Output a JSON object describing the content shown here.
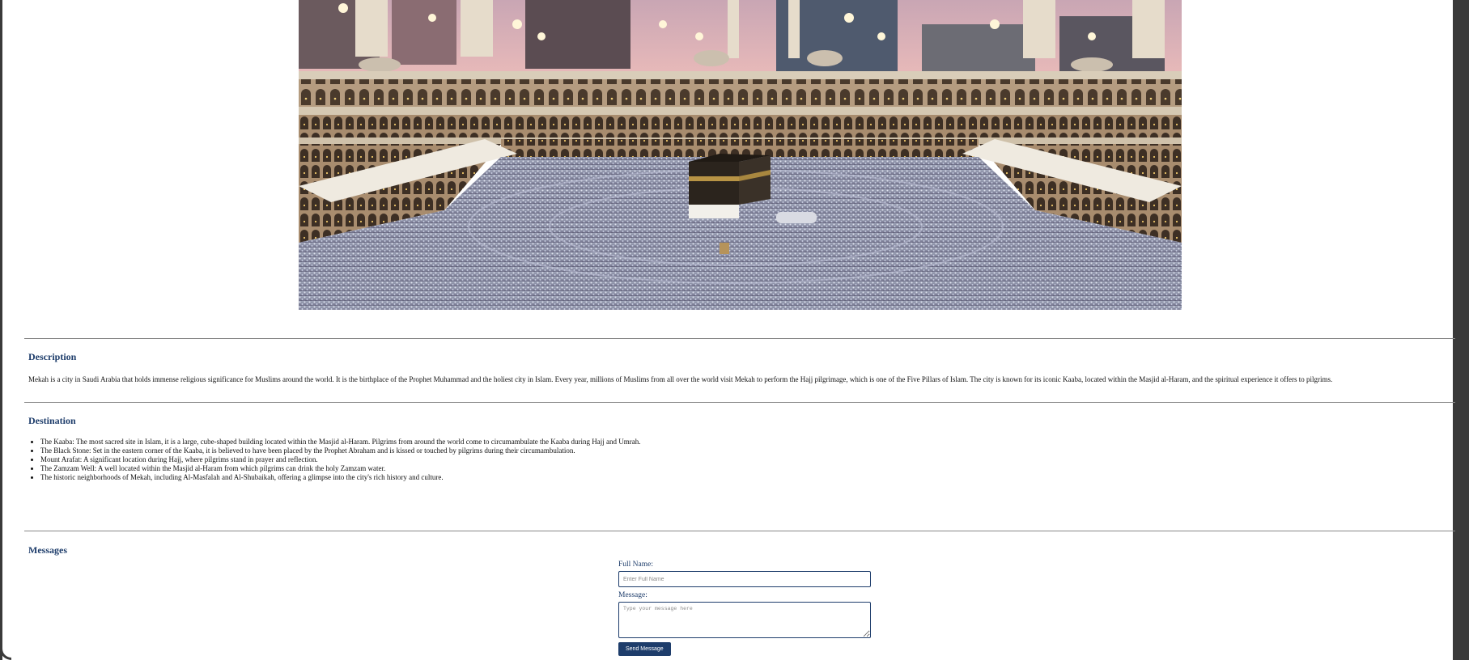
{
  "hero": {
    "image": "mecca-masjid-al-haram-photo"
  },
  "description": {
    "title": "Description",
    "text": "Mekah is a city in Saudi Arabia that holds immense religious significance for Muslims around the world. It is the birthplace of the Prophet Muhammad and the holiest city in Islam. Every year, millions of Muslims from all over the world visit Mekah to perform the Hajj pilgrimage, which is one of the Five Pillars of Islam. The city is known for its iconic Kaaba, located within the Masjid al-Haram, and the spiritual experience it offers to pilgrims."
  },
  "destination": {
    "title": "Destination",
    "items": [
      "The Kaaba: The most sacred site in Islam, it is a large, cube-shaped building located within the Masjid al-Haram. Pilgrims from around the world come to circumambulate the Kaaba during Hajj and Umrah.",
      "The Black Stone: Set in the eastern corner of the Kaaba, it is believed to have been placed by the Prophet Abraham and is kissed or touched by pilgrims during their circumambulation.",
      "Mount Arafat: A significant location during Hajj, where pilgrims stand in prayer and reflection.",
      "The Zamzam Well: A well located within the Masjid al-Haram from which pilgrims can drink the holy Zamzam water.",
      "The historic neighborhoods of Mekah, including Al-Masfalah and Al-Shubaikah, offering a glimpse into the city's rich history and culture."
    ]
  },
  "messages": {
    "title": "Messages",
    "full_name_label": "Full Name:",
    "full_name_placeholder": "Enter Full Name",
    "message_label": "Message:",
    "message_placeholder": "Type your message here",
    "send_label": "Send Message"
  },
  "colors": {
    "heading": "#1e3d6b",
    "button_bg": "#1e3d6b",
    "rule": "#888888"
  }
}
